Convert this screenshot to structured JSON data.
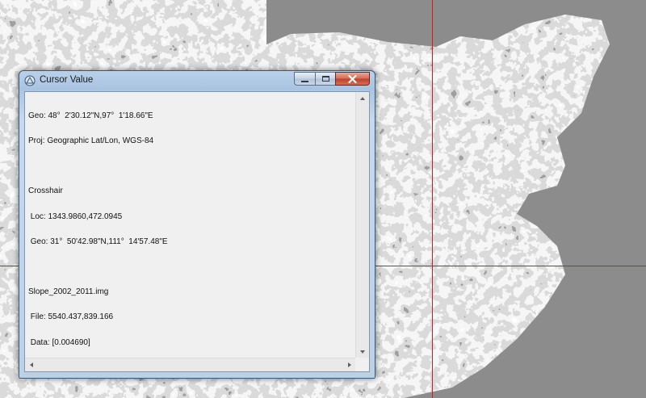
{
  "window": {
    "title": "Cursor Value",
    "icon": "envi-cursor-icon",
    "close_color": "#c2412b"
  },
  "crosshair_color": "#e0141a",
  "cursor_info": {
    "geo": "Geo: 48°  2'30.12\"N,97°  1'18.66\"E",
    "proj": "Proj: Geographic Lat/Lon, WGS-84",
    "crosshair_heading": "Crosshair",
    "crosshair_loc": " Loc: 1343.9860,472.0945",
    "crosshair_geo": " Geo: 31°  50'42.98\"N,111°  14'57.48\"E",
    "file_name": "Slope_2002_2011.img",
    "file_coords": " File: 5540.437,839.166",
    "data_value": " Data: [0.004690]"
  }
}
